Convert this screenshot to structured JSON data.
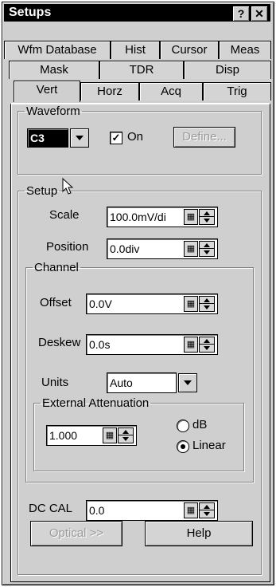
{
  "window": {
    "title": "Setups",
    "help_glyph": "?",
    "close_glyph": "✕"
  },
  "tabs": {
    "row1": [
      "Wfm Database",
      "Hist",
      "Cursor",
      "Meas"
    ],
    "row2": [
      "Mask",
      "TDR",
      "Disp"
    ],
    "row3": [
      "Vert",
      "Horz",
      "Acq",
      "Trig"
    ],
    "active": "Vert"
  },
  "waveform": {
    "legend": "Waveform",
    "source": "C3",
    "on_label": "On",
    "on_checked": true,
    "define_label": "Define..."
  },
  "setup": {
    "legend": "Setup",
    "scale_label": "Scale",
    "scale_value": "100.0mV/di",
    "position_label": "Position",
    "position_value": "0.0div"
  },
  "channel": {
    "legend": "Channel",
    "offset_label": "Offset",
    "offset_value": "0.0V",
    "deskew_label": "Deskew",
    "deskew_value": "0.0s",
    "units_label": "Units",
    "units_value": "Auto"
  },
  "attenuation": {
    "legend": "External Attenuation",
    "value": "1.000",
    "db_label": "dB",
    "linear_label": "Linear",
    "selected": "Linear"
  },
  "dccal": {
    "label": "DC CAL",
    "value": "0.0"
  },
  "buttons": {
    "optical_label": "Optical >>",
    "help_label": "Help"
  },
  "icons": {
    "keypad": "keypad-icon",
    "spin": "spinner-arrows-icon",
    "cursor": "mouse-pointer-icon"
  },
  "colors": {
    "titlebar": "#000000",
    "face": "#cfcfcf",
    "disabled_text": "#9a9a9a"
  }
}
